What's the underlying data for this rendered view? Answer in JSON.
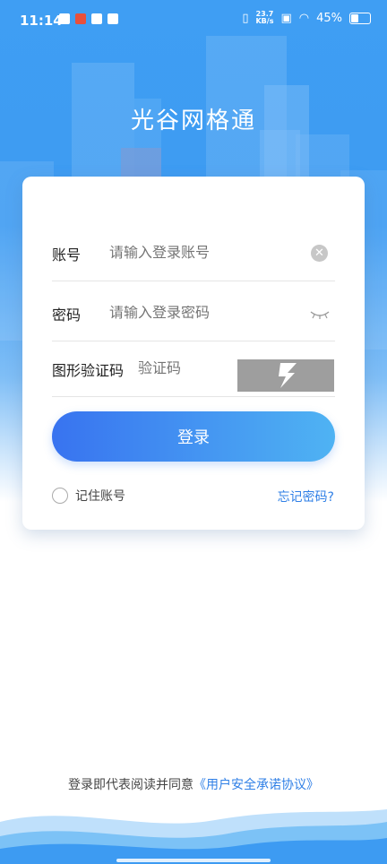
{
  "status_bar": {
    "time": "11:14",
    "net_speed_value": "23.7",
    "net_speed_unit": "KB/s",
    "battery_percent": "45%"
  },
  "app": {
    "title": "光谷网格通"
  },
  "form": {
    "account": {
      "label": "账号",
      "placeholder": "请输入登录账号"
    },
    "password": {
      "label": "密码",
      "placeholder": "请输入登录密码"
    },
    "captcha": {
      "label": "图形验证码",
      "placeholder": "验证码"
    },
    "login_label": "登录",
    "remember_label": "记住账号",
    "forgot_label": "忘记密码?"
  },
  "agreement": {
    "prefix": "登录即代表阅读并同意",
    "link": "《用户安全承诺协议》"
  },
  "colors": {
    "primary_blue": "#3d9bf2",
    "button_start": "#3873f0",
    "button_end": "#4fb3f3",
    "link": "#2f7fe6"
  },
  "icons": [
    "mail-icon",
    "notification-icon",
    "clear-icon",
    "eye-closed-icon",
    "captcha-image"
  ]
}
